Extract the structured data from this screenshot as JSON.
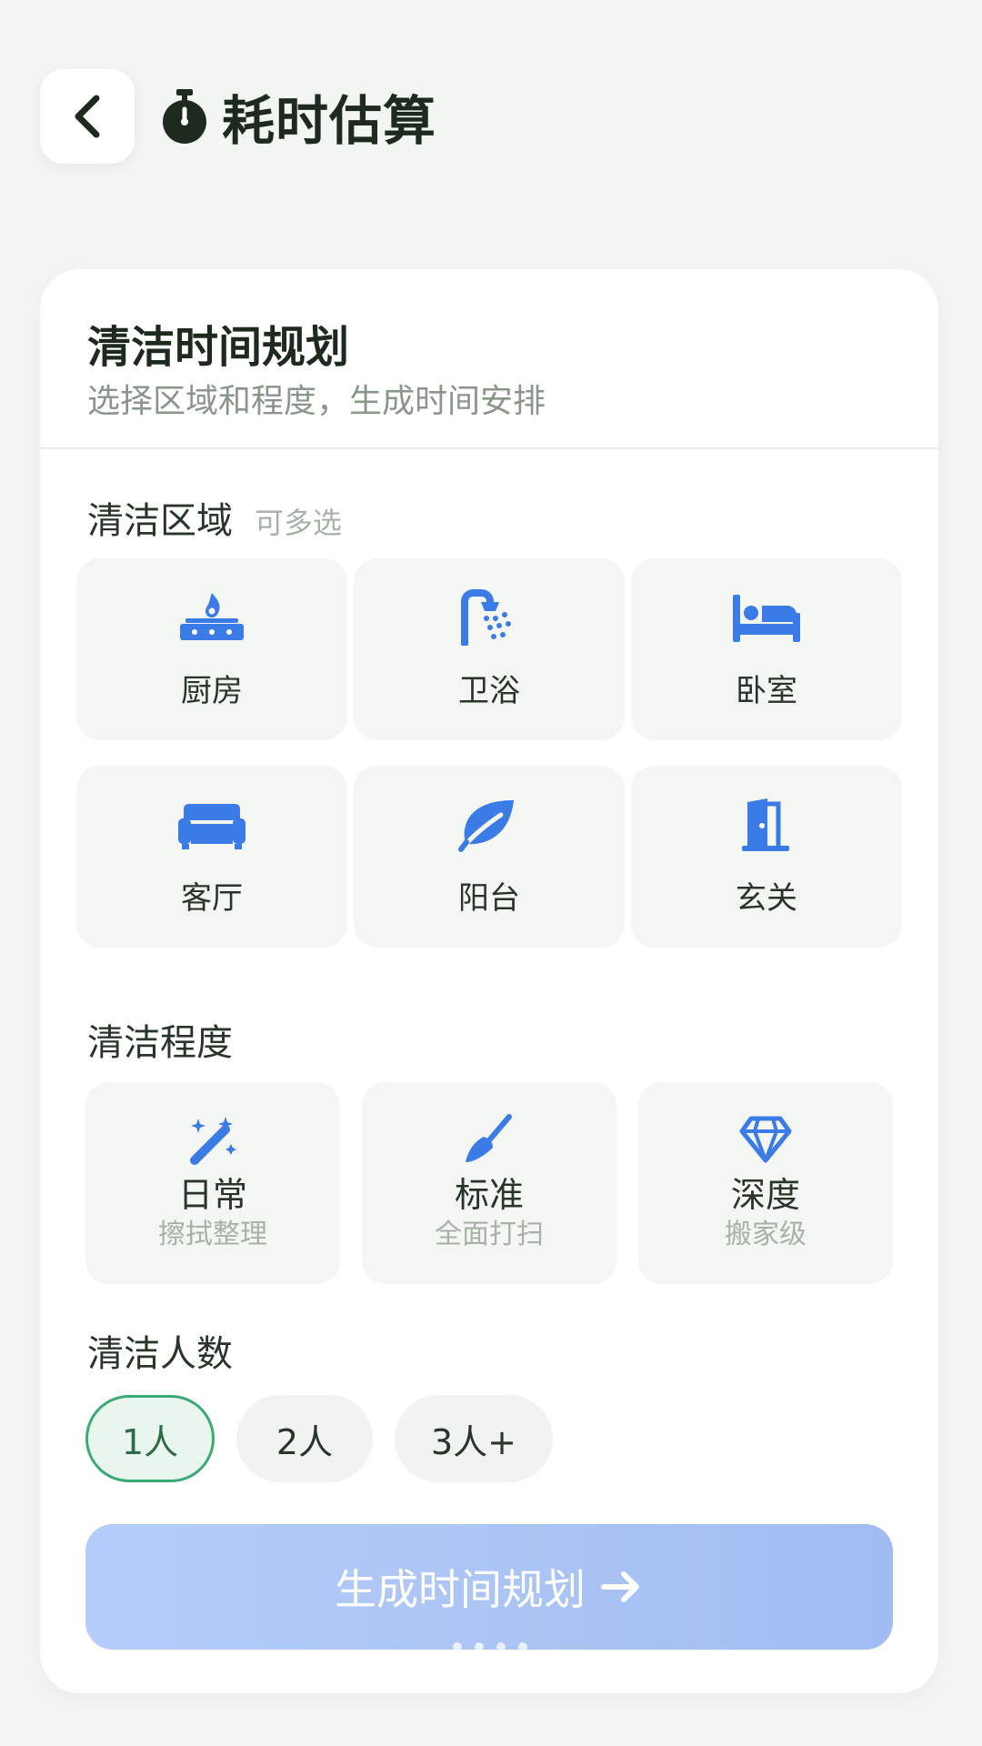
{
  "header": {
    "back_icon": "chevron-left-icon",
    "title_icon": "stopwatch-icon",
    "title": "耗时估算"
  },
  "card": {
    "title": "清洁时间规划",
    "subtitle": "选择区域和程度，生成时间安排"
  },
  "areas": {
    "label": "清洁区域",
    "hint": "可多选",
    "items": [
      {
        "label": "厨房",
        "icon": "stove-fire-icon"
      },
      {
        "label": "卫浴",
        "icon": "shower-icon"
      },
      {
        "label": "卧室",
        "icon": "bed-icon"
      },
      {
        "label": "客厅",
        "icon": "sofa-icon"
      },
      {
        "label": "阳台",
        "icon": "leaf-icon"
      },
      {
        "label": "玄关",
        "icon": "door-icon"
      }
    ]
  },
  "level": {
    "label": "清洁程度",
    "items": [
      {
        "name": "日常",
        "desc": "擦拭整理",
        "icon": "magic-wand-icon"
      },
      {
        "name": "标准",
        "desc": "全面打扫",
        "icon": "broom-icon"
      },
      {
        "name": "深度",
        "desc": "搬家级",
        "icon": "diamond-icon"
      }
    ]
  },
  "people": {
    "label": "清洁人数",
    "options": [
      "1人",
      "2人",
      "3人+"
    ],
    "selected": "1人"
  },
  "action": {
    "label": "生成时间规划",
    "icon": "arrow-right-icon"
  },
  "colors": {
    "icon_blue": "#3b7be6",
    "accent_green": "#3aaa73",
    "button_gradient_start": "#b5cdfa",
    "button_gradient_end": "#a0bcf2"
  }
}
